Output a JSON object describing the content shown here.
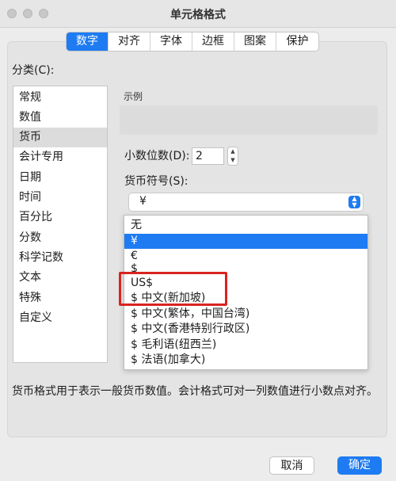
{
  "window": {
    "title": "单元格格式"
  },
  "tabs": [
    {
      "label": "数字",
      "active": true
    },
    {
      "label": "对齐"
    },
    {
      "label": "字体"
    },
    {
      "label": "边框"
    },
    {
      "label": "图案"
    },
    {
      "label": "保护"
    }
  ],
  "category": {
    "label": "分类(C):",
    "items": [
      "常规",
      "数值",
      "货币",
      "会计专用",
      "日期",
      "时间",
      "百分比",
      "分数",
      "科学记数",
      "文本",
      "特殊",
      "自定义"
    ],
    "selected": "货币"
  },
  "example": {
    "label": "示例",
    "value": ""
  },
  "decimal": {
    "label": "小数位数(D):",
    "value": "2"
  },
  "currency_symbol": {
    "label": "货币符号(S):",
    "value": "¥",
    "options": [
      "无",
      "¥",
      "€",
      "$",
      "US$",
      "$ 中文(新加坡)",
      "$ 中文(繁体，中国台湾)",
      "$ 中文(香港特别行政区)",
      "$ 毛利语(纽西兰)",
      "$ 法语(加拿大)"
    ],
    "selected": "¥"
  },
  "description": "货币格式用于表示一般货币数值。会计格式可对一列数值进行小数点对齐。",
  "buttons": {
    "cancel": "取消",
    "ok": "确定"
  },
  "colors": {
    "accent": "#1e7bf2",
    "highlight_box": "#d9231e"
  },
  "icons": {
    "stepper": "stepper-arrows",
    "select_arrow": "updown-chevron-icon"
  }
}
